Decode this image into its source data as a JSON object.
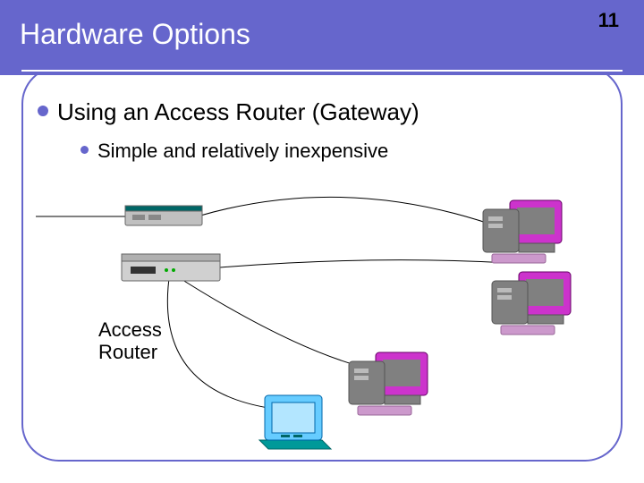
{
  "header": {
    "title": "Hardware Options",
    "page_number": "11"
  },
  "bullets": {
    "main": "Using an Access Router (Gateway)",
    "sub": "Simple and relatively inexpensive"
  },
  "labels": {
    "access_router": "Access\nRouter"
  },
  "colors": {
    "accent": "#6666cc",
    "magenta": "#cc33cc",
    "gray": "#808080",
    "teal": "#008080"
  }
}
